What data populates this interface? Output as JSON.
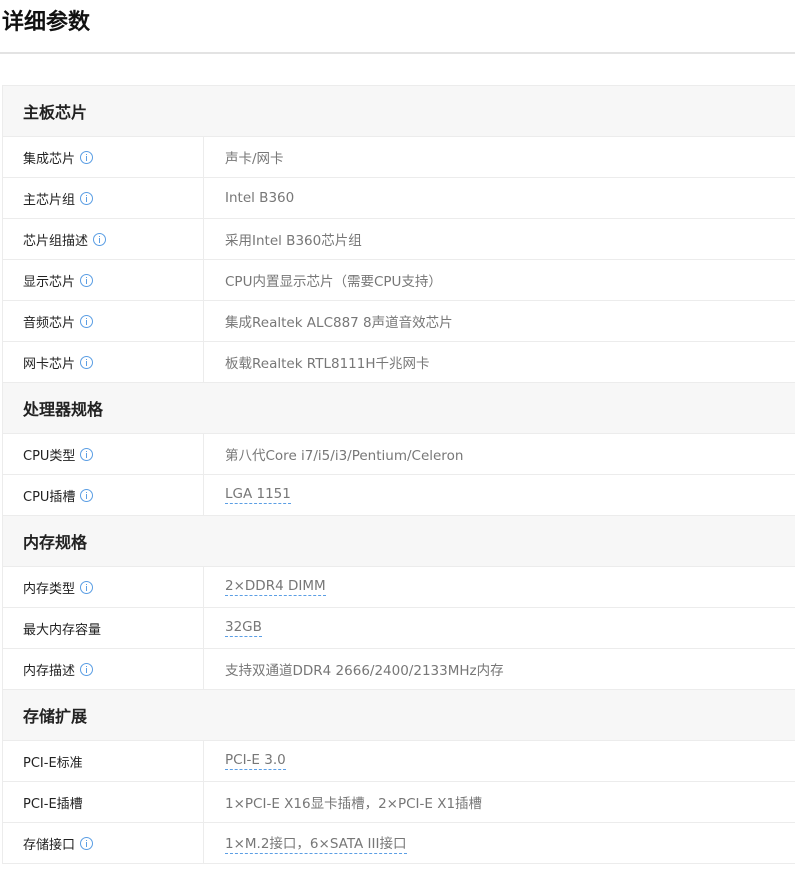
{
  "page_title": "详细参数",
  "colors": {
    "section_bg": "#f7f7f7",
    "border": "#ececec",
    "info_icon": "#5b9ee4",
    "value_text": "#777777",
    "label_text": "#222222"
  },
  "sections": [
    {
      "title": "主板芯片",
      "rows": [
        {
          "name": "集成芯片",
          "value": "声卡/网卡",
          "info": true,
          "link": false
        },
        {
          "name": "主芯片组",
          "value": "Intel B360",
          "info": true,
          "link": false
        },
        {
          "name": "芯片组描述",
          "value": "采用Intel B360芯片组",
          "info": true,
          "link": false
        },
        {
          "name": "显示芯片",
          "value": "CPU内置显示芯片（需要CPU支持）",
          "info": true,
          "link": false
        },
        {
          "name": "音频芯片",
          "value": "集成Realtek ALC887 8声道音效芯片",
          "info": true,
          "link": false
        },
        {
          "name": "网卡芯片",
          "value": "板载Realtek RTL8111H千兆网卡",
          "info": true,
          "link": false
        }
      ]
    },
    {
      "title": "处理器规格",
      "rows": [
        {
          "name": "CPU类型",
          "value": "第八代Core i7/i5/i3/Pentium/Celeron",
          "info": true,
          "link": false
        },
        {
          "name": "CPU插槽",
          "value": "LGA 1151",
          "info": true,
          "link": true
        }
      ]
    },
    {
      "title": "内存规格",
      "rows": [
        {
          "name": "内存类型",
          "value": "2×DDR4 DIMM",
          "info": true,
          "link": true
        },
        {
          "name": "最大内存容量",
          "value": "32GB",
          "info": false,
          "link": true
        },
        {
          "name": "内存描述",
          "value": "支持双通道DDR4 2666/2400/2133MHz内存",
          "info": true,
          "link": false
        }
      ]
    },
    {
      "title": "存储扩展",
      "rows": [
        {
          "name": "PCI-E标准",
          "value": "PCI-E 3.0",
          "info": false,
          "link": true
        },
        {
          "name": "PCI-E插槽",
          "value": "1×PCI-E X16显卡插槽，2×PCI-E X1插槽",
          "info": false,
          "link": false
        },
        {
          "name": "存储接口",
          "value": "1×M.2接口，6×SATA III接口",
          "info": true,
          "link": true
        }
      ]
    }
  ]
}
